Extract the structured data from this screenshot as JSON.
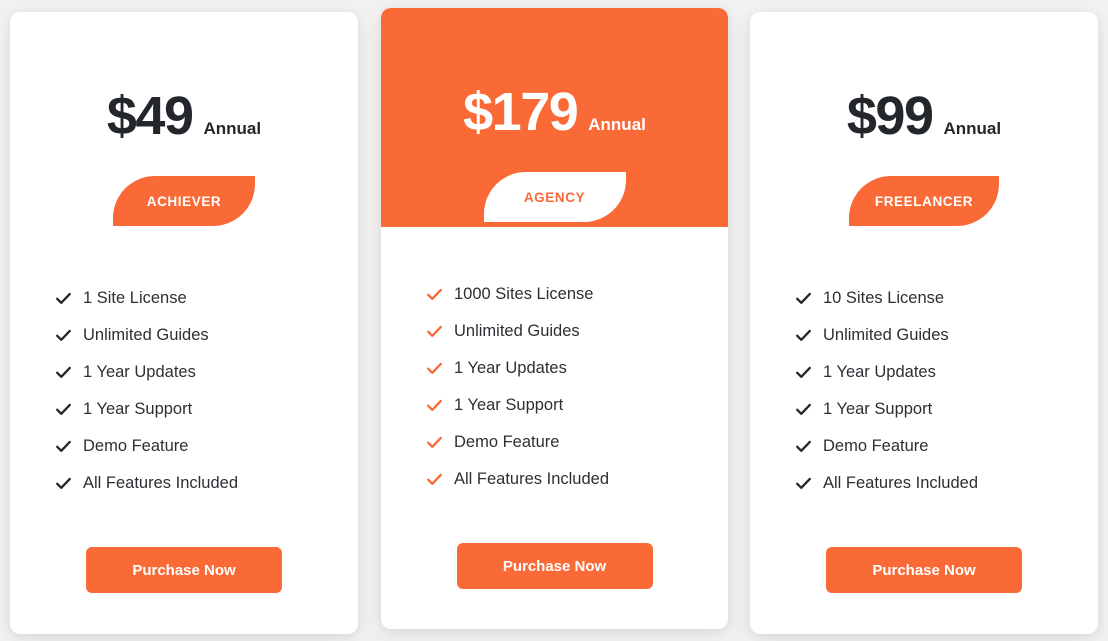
{
  "theme": {
    "accent": "#f96a36",
    "page_background": "#f2f0f0",
    "card_background": "#ffffff",
    "text_dark": "#23272b"
  },
  "plans": [
    {
      "id": "achiever",
      "price": "$49",
      "period": "Annual",
      "badge": "ACHIEVER",
      "featured": false,
      "check_icon": "check-icon",
      "features": [
        "1 Site License",
        "Unlimited Guides",
        "1 Year Updates",
        "1 Year Support",
        "Demo Feature",
        "All Features Included"
      ],
      "cta": "Purchase Now"
    },
    {
      "id": "agency",
      "price": "$179",
      "period": "Annual",
      "badge": "AGENCY",
      "featured": true,
      "check_icon": "check-icon",
      "features": [
        "1000 Sites License",
        "Unlimited Guides",
        "1 Year Updates",
        "1 Year Support",
        "Demo Feature",
        "All Features Included"
      ],
      "cta": "Purchase Now"
    },
    {
      "id": "freelancer",
      "price": "$99",
      "period": "Annual",
      "badge": "FREELANCER",
      "featured": false,
      "check_icon": "check-icon",
      "features": [
        "10 Sites License",
        "Unlimited Guides",
        "1 Year Updates",
        "1 Year Support",
        "Demo Feature",
        "All Features Included"
      ],
      "cta": "Purchase Now"
    }
  ]
}
